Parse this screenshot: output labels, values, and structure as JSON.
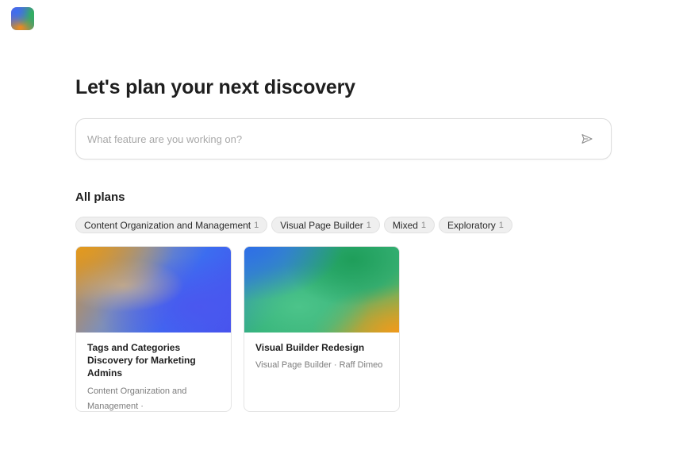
{
  "header": {
    "logo_icon": "app-logo-gradient"
  },
  "main": {
    "title": "Let's plan your next discovery",
    "search": {
      "placeholder": "What feature are you working on?",
      "value": "",
      "send_icon": "send-icon"
    },
    "plans": {
      "section_title": "All plans",
      "filters": [
        {
          "label": "Content Organization and Management",
          "count": "1"
        },
        {
          "label": "Visual Page Builder",
          "count": "1"
        },
        {
          "label": "Mixed",
          "count": "1"
        },
        {
          "label": "Exploratory",
          "count": "1"
        }
      ],
      "cards": [
        {
          "title": "Tags and Categories Discovery for Marketing Admins",
          "meta": "Content Organization and Management ·"
        },
        {
          "title": "Visual Builder Redesign",
          "meta": "Visual Page Builder · Raff Dimeo"
        }
      ]
    }
  },
  "colors": {
    "background": "#ffffff",
    "chip_bg": "#efefef",
    "text_primary": "#1f1f1f",
    "text_secondary": "#7c7c7c"
  }
}
